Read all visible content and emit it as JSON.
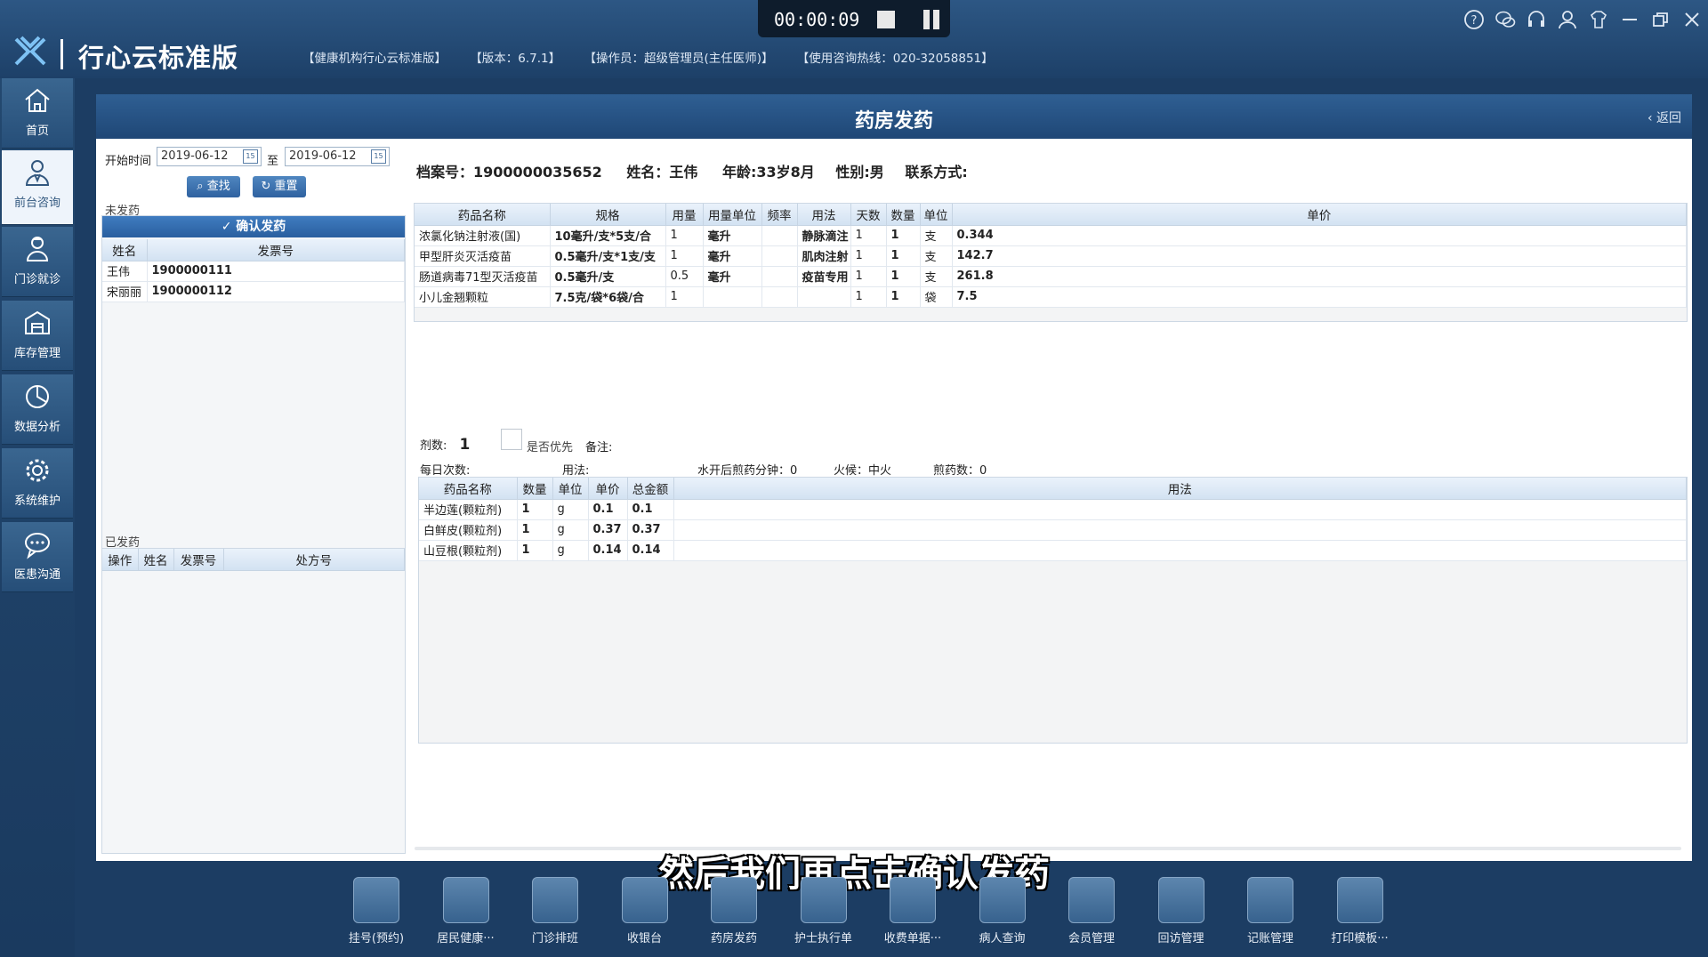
{
  "app": {
    "title": "行心云标准版",
    "info": [
      "【健康机构行心云标准版】",
      "【版本：6.7.1】",
      "【操作员：超级管理员(主任医师)】",
      "【使用咨询热线：020-32058851】"
    ]
  },
  "recorder": {
    "time": "00:00:09"
  },
  "sidebar": {
    "items": [
      {
        "label": "首页",
        "icon": "home-icon"
      },
      {
        "label": "前台咨询",
        "icon": "consultant-icon"
      },
      {
        "label": "门诊就诊",
        "icon": "doctor-icon"
      },
      {
        "label": "库存管理",
        "icon": "warehouse-icon"
      },
      {
        "label": "数据分析",
        "icon": "pie-chart-icon"
      },
      {
        "label": "系统维护",
        "icon": "gear-icon"
      },
      {
        "label": "医患沟通",
        "icon": "chat-icon"
      }
    ]
  },
  "page": {
    "title": "药房发药",
    "back": "返回"
  },
  "filter": {
    "start_label": "开始时间",
    "start_date": "2019-06-12",
    "to_label": "至",
    "end_date": "2019-06-12",
    "search": "查找",
    "reset": "重置"
  },
  "pending": {
    "section": "未发药",
    "confirm": "确认发药",
    "headers": [
      "姓名",
      "发票号"
    ],
    "rows": [
      [
        "王伟",
        "1900000111"
      ],
      [
        "宋丽丽",
        "1900000112"
      ]
    ]
  },
  "dispensed": {
    "section": "已发药",
    "headers": [
      "操作",
      "姓名",
      "发票号",
      "处方号"
    ]
  },
  "patient": {
    "record_label": "档案号：",
    "record": "1900000035652",
    "name_label": "姓名：",
    "name": "王伟",
    "age": "年龄:33岁8月",
    "gender": "性别:男",
    "contact": "联系方式:"
  },
  "drug_table": {
    "headers": [
      "药品名称",
      "规格",
      "用量",
      "用量单位",
      "频率",
      "用法",
      "天数",
      "数量",
      "单位",
      "单价"
    ],
    "rows": [
      [
        "浓氯化钠注射液(国)",
        "10毫升/支*5支/合",
        "1",
        "毫升",
        "",
        "静脉滴注",
        "1",
        "1",
        "支",
        "0.344"
      ],
      [
        "甲型肝炎灭活疫苗",
        "0.5毫升/支*1支/支",
        "1",
        "毫升",
        "",
        "肌肉注射",
        "1",
        "1",
        "支",
        "142.7"
      ],
      [
        "肠道病毒71型灭活疫苗",
        "0.5毫升/支",
        "0.5",
        "毫升",
        "",
        "疫苗专用",
        "1",
        "1",
        "支",
        "261.8"
      ],
      [
        "小儿金翘颗粒",
        "7.5克/袋*6袋/合",
        "1",
        "",
        "",
        "",
        "1",
        "1",
        "袋",
        "7.5"
      ]
    ]
  },
  "herbal": {
    "doses_label": "剂数:",
    "doses": "1",
    "priority": "是否优先",
    "remark": "备注:",
    "daily_label": "每日次数:",
    "usage_label": "用法:",
    "decoct": "水开后煎药分钟：0",
    "fire": "火候：中火",
    "decoct_count": "煎药数：0",
    "headers": [
      "药品名称",
      "数量",
      "单位",
      "单价",
      "总金额",
      "用法"
    ],
    "rows": [
      [
        "半边莲(颗粒剂)",
        "1",
        "g",
        "0.1",
        "0.1",
        ""
      ],
      [
        "白鲜皮(颗粒剂)",
        "1",
        "g",
        "0.37",
        "0.37",
        ""
      ],
      [
        "山豆根(颗粒剂)",
        "1",
        "g",
        "0.14",
        "0.14",
        ""
      ]
    ]
  },
  "subtitle": "然后我们再点击确认发药",
  "toolbar": [
    {
      "label": "挂号(预约)",
      "icon": "register-icon"
    },
    {
      "label": "居民健康···",
      "icon": "resident-health-icon"
    },
    {
      "label": "门诊排班",
      "icon": "schedule-icon"
    },
    {
      "label": "收银台",
      "icon": "cashier-icon"
    },
    {
      "label": "药房发药",
      "icon": "pharmacy-icon"
    },
    {
      "label": "护士执行单",
      "icon": "nurse-order-icon"
    },
    {
      "label": "收费单据···",
      "icon": "receipt-icon"
    },
    {
      "label": "病人查询",
      "icon": "patient-search-icon"
    },
    {
      "label": "会员管理",
      "icon": "vip-icon"
    },
    {
      "label": "回访管理",
      "icon": "followup-icon"
    },
    {
      "label": "记账管理",
      "icon": "ledger-icon"
    },
    {
      "label": "打印模板···",
      "icon": "print-icon"
    }
  ]
}
